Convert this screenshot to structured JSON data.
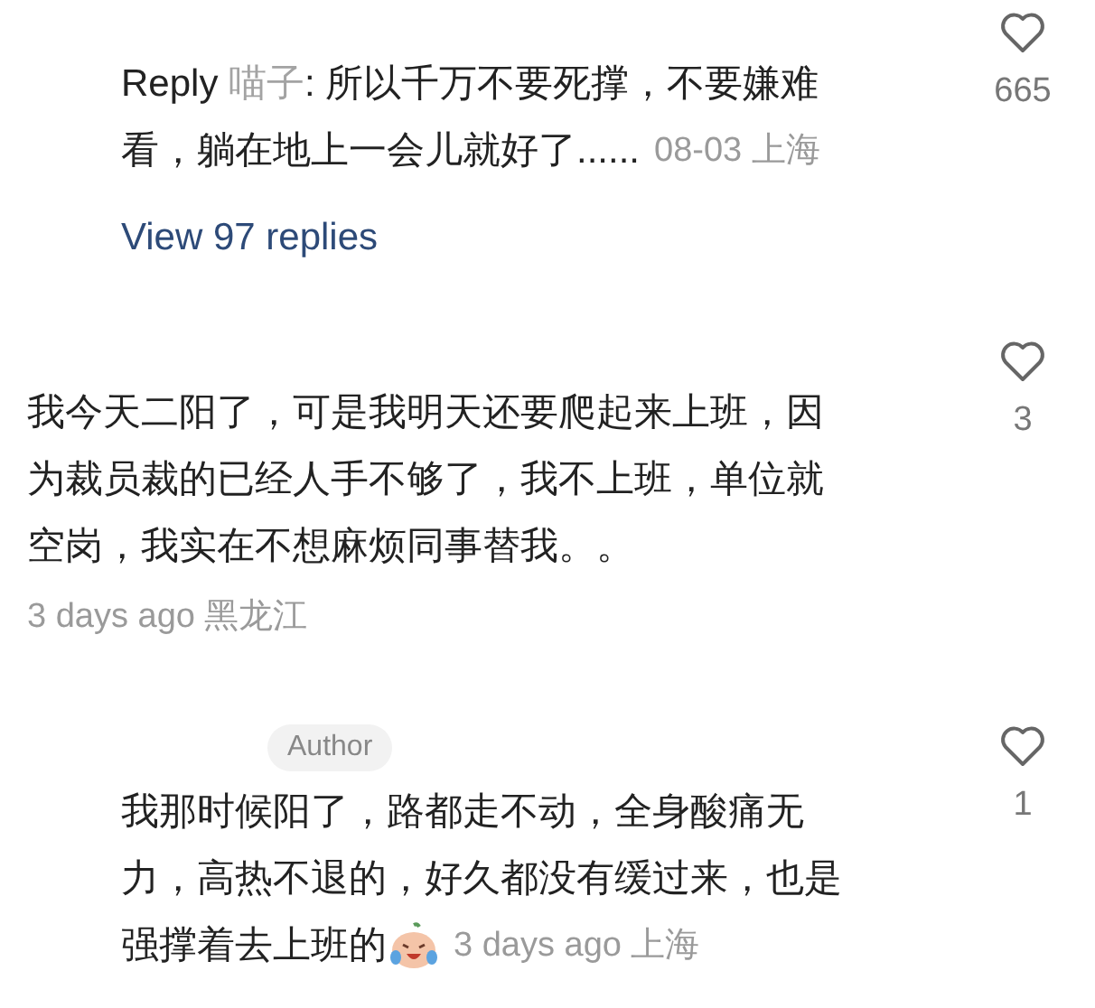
{
  "items": [
    {
      "kind": "reply",
      "label": "Reply",
      "author": "喵子",
      "lines": [
        ": 所以千万不要死撑，不要嫌难",
        "看，躺在地上一会儿就好了......"
      ],
      "meta": "08-03 上海",
      "likes": "665"
    },
    {
      "kind": "more_replies",
      "text": "View 97 replies"
    },
    {
      "kind": "comment",
      "lines": [
        "我今天二阳了，可是我明天还要爬起来上班，因",
        "为裁员裁的已经人手不够了，我不上班，单位就",
        "空岗，我实在不想麻烦同事替我。。"
      ],
      "meta": "3 days ago 黑龙江",
      "likes": "3"
    },
    {
      "kind": "reply",
      "badge": "Author",
      "lines": [
        "我那时候阳了，路都走不动，全身酸痛无",
        "力，高热不退的，好久都没有缓过来，也是",
        "强撑着去上班的"
      ],
      "emoji": true,
      "meta": "3 days ago 上海",
      "likes": "1"
    }
  ]
}
